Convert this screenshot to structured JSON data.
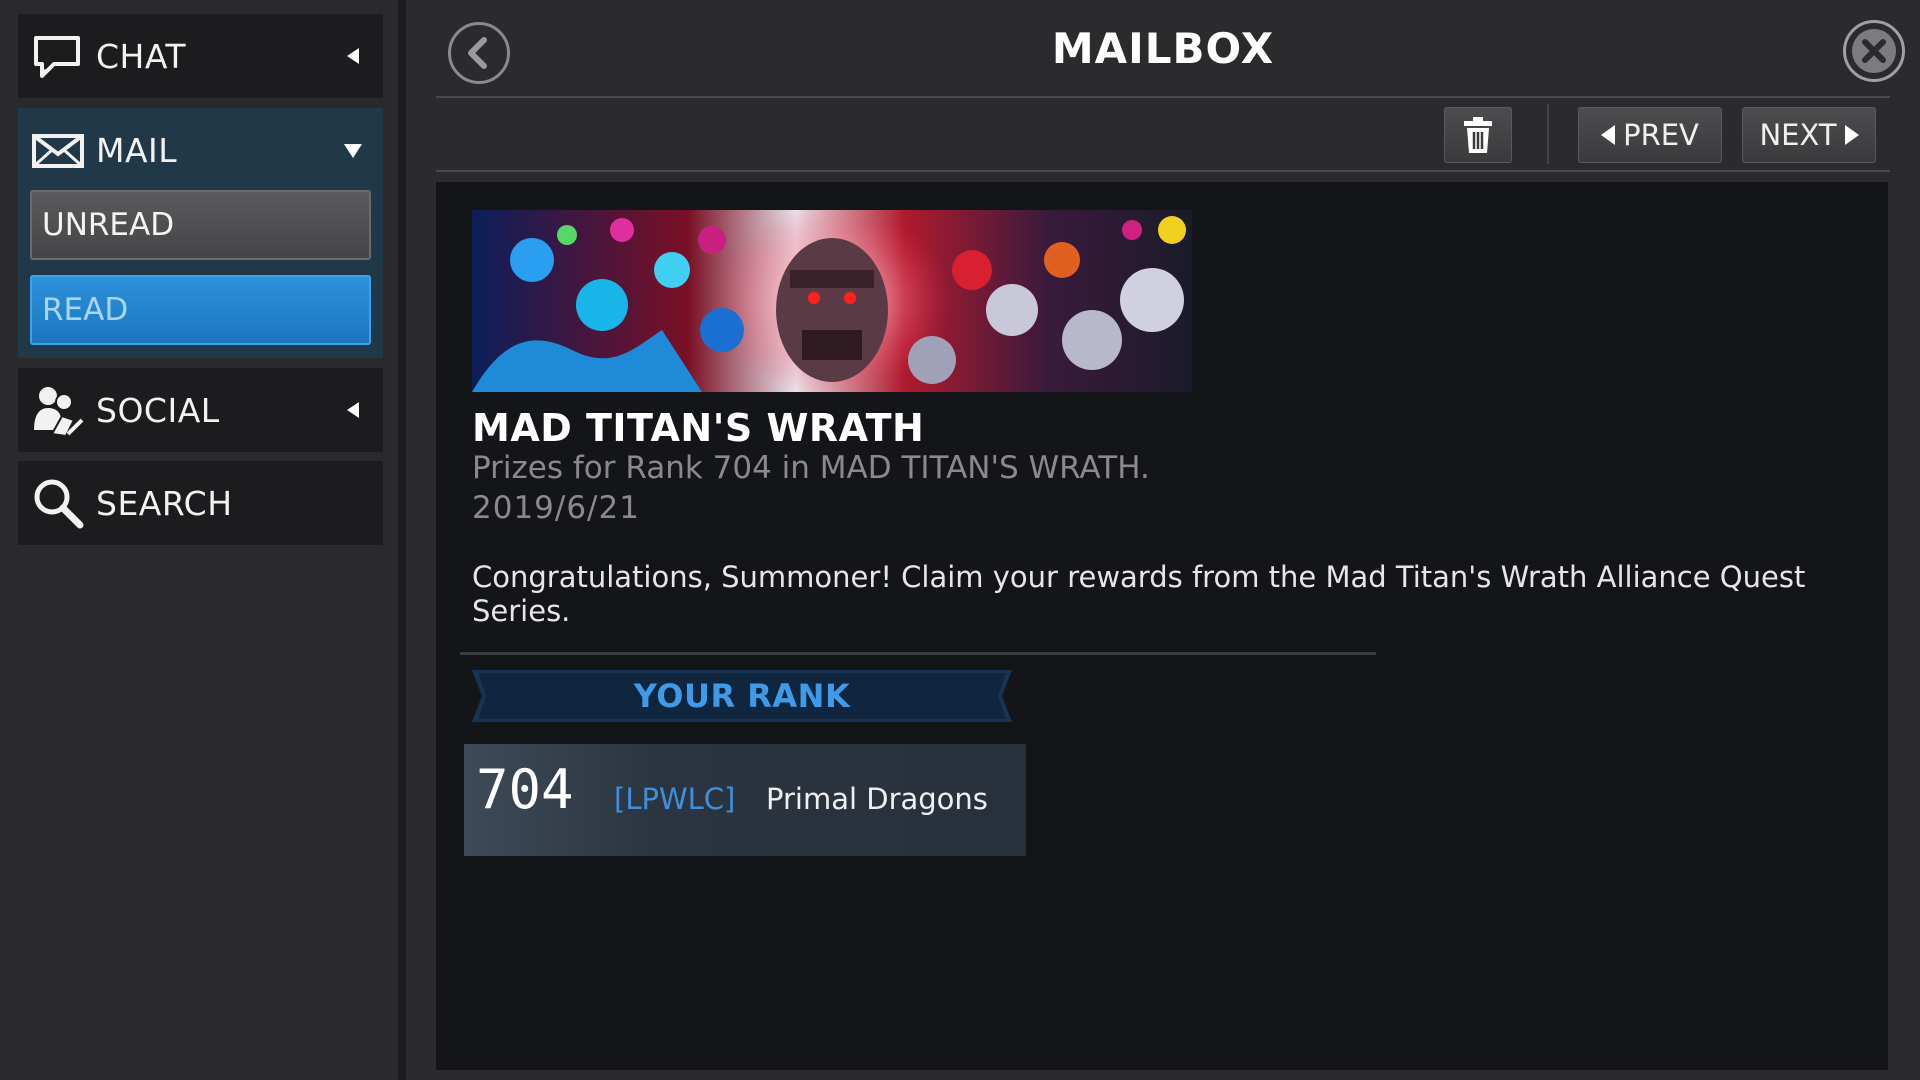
{
  "sidebar": {
    "chat": {
      "label": "CHAT",
      "icon": "chat-bubble-icon",
      "caret": "caret-left-icon"
    },
    "mail": {
      "label": "MAIL",
      "icon": "envelope-icon",
      "caret": "caret-down-icon"
    },
    "unread": {
      "label": "UNREAD"
    },
    "read": {
      "label": "READ",
      "selected": true
    },
    "social": {
      "label": "SOCIAL",
      "icon": "people-icon",
      "caret": "caret-left-icon"
    },
    "search": {
      "label": "SEARCH",
      "icon": "magnifier-icon"
    }
  },
  "header": {
    "title": "MAILBOX",
    "back_icon": "back-arrow-icon",
    "close_icon": "close-icon"
  },
  "toolbar": {
    "trash_icon": "trash-icon",
    "prev_label": "PREV",
    "next_label": "NEXT"
  },
  "message": {
    "title": "MAD TITAN'S WRATH",
    "subtitle": "Prizes for Rank 704 in MAD TITAN'S WRATH.",
    "date": "2019/6/21",
    "body": "Congratulations, Summoner! Claim your rewards from the Mad Titan's Wrath Alliance Quest Series.",
    "rank_header": "YOUR RANK",
    "rank": {
      "number": "704",
      "tag": "[LPWLC]",
      "alliance": "Primal Dragons"
    }
  },
  "colors": {
    "background": "#2b2b2d",
    "panel": "#141518",
    "accent_blue": "#1f86d0",
    "mail_block": "#213848",
    "rank_header_text": "#3f9bea"
  }
}
